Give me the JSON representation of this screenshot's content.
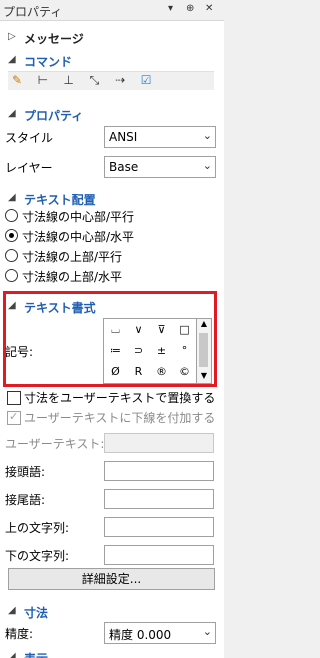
{
  "titlebar": {
    "title": "プロパティ",
    "pin_glyph": "▾ ⊕ ✕"
  },
  "sections": {
    "message": "メッセージ",
    "command": "コマンド",
    "property": "プロパティ",
    "text_align": "テキスト配置",
    "text_format": "テキスト書式",
    "dimension": "寸法",
    "display": "表示"
  },
  "tools": [
    "pencil-icon",
    "dimension-line-icon",
    "dimension-bar-icon",
    "rotate-dimension-icon",
    "leader-icon",
    "check-settings-icon"
  ],
  "property": {
    "style_label": "スタイル",
    "style_value": "ANSI",
    "layer_label": "レイヤー",
    "layer_value": "Base"
  },
  "alignment": {
    "options": [
      "寸法線の中心部/平行",
      "寸法線の中心部/水平",
      "寸法線の上部/平行",
      "寸法線の上部/水平"
    ],
    "selected_index": 1
  },
  "format": {
    "symbol_label": "記号:",
    "symbols": [
      "⌴",
      "∨",
      "⊽",
      "□",
      "≔",
      "⊃",
      "±",
      "°",
      "Ø",
      "R",
      "®",
      "©"
    ],
    "replace_label": "寸法をユーザーテキストで置換する",
    "underline_label": "ユーザーテキストに下線を付加する",
    "user_text_label": "ユーザーテキスト:",
    "prefix_label": "接頭語:",
    "suffix_label": "接尾語:",
    "upper_label": "上の文字列:",
    "lower_label": "下の文字列:",
    "detail_button": "詳細設定..."
  },
  "dimension": {
    "precision_label": "精度:",
    "precision_value": "精度 0.000"
  }
}
